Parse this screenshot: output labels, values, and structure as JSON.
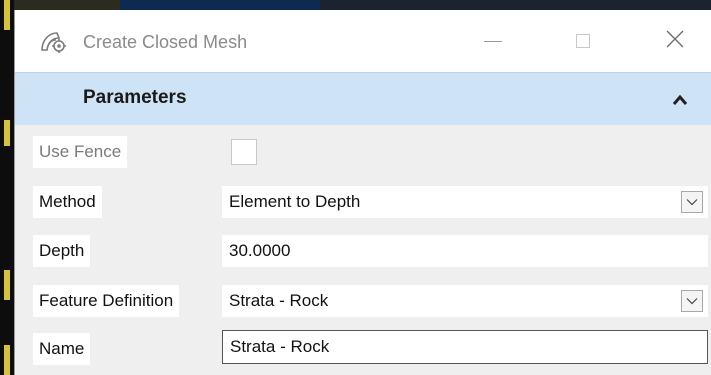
{
  "window": {
    "title": "Create Closed Mesh",
    "icon": "mesh-tool-icon",
    "controls": [
      "minimize-icon",
      "maximize-icon",
      "close-icon"
    ]
  },
  "parameters": {
    "header": "Parameters",
    "collapse_icon": "chevron-up-icon",
    "use_fence": {
      "label": "Use Fence",
      "checked": false,
      "enabled": false
    },
    "method": {
      "label": "Method",
      "value": "Element to Depth"
    },
    "depth": {
      "label": "Depth",
      "value": "30.0000"
    },
    "feature_definition": {
      "label": "Feature Definition",
      "value": "Strata - Rock"
    },
    "name": {
      "label": "Name",
      "value": "Strata - Rock"
    }
  },
  "colors": {
    "header_bg": "#cfe3f7",
    "body_bg": "#efefef",
    "title_text": "#8a8a8a"
  }
}
